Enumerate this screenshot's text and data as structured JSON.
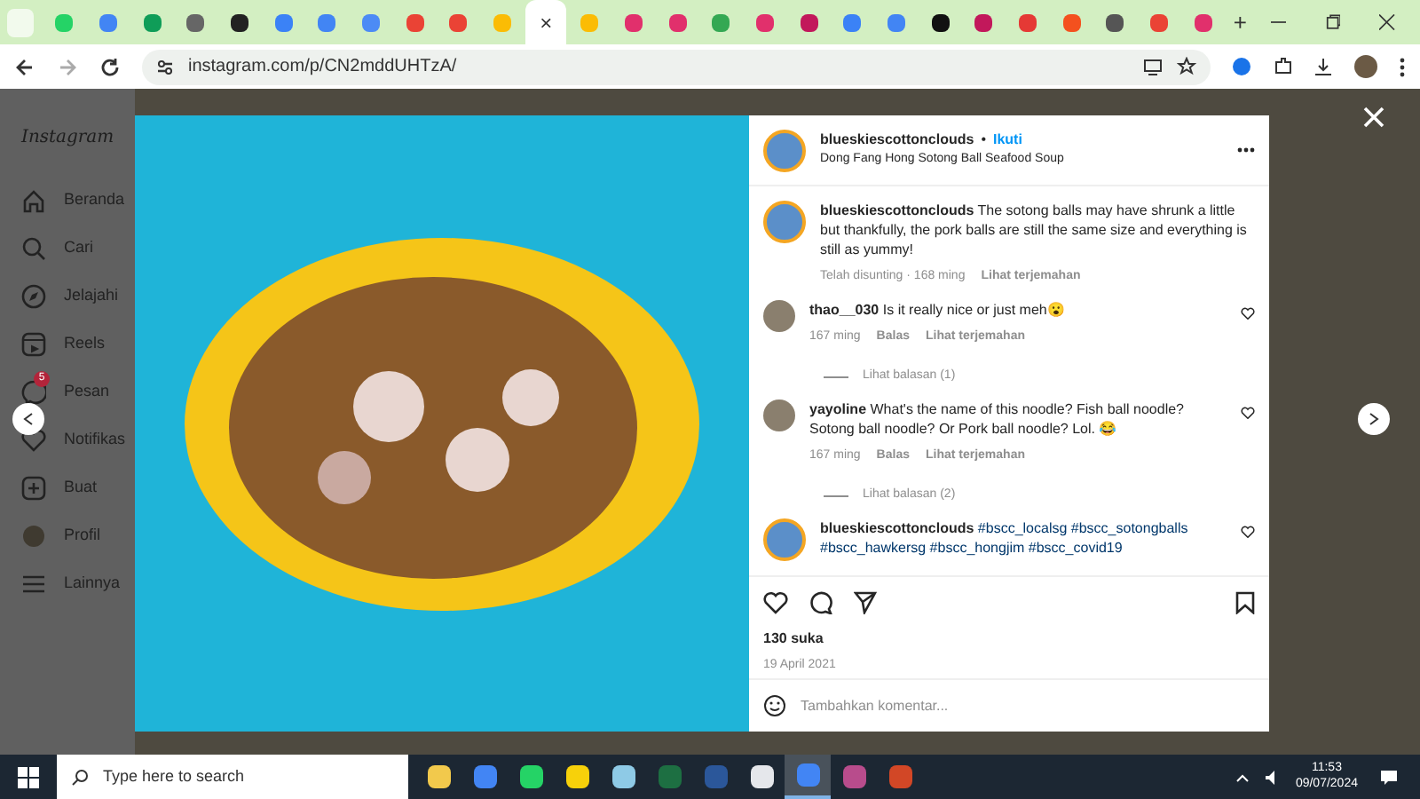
{
  "browser": {
    "tabs": [
      {
        "color": "#25d366",
        "selected": false
      },
      {
        "color": "#4285f4",
        "selected": false
      },
      {
        "color": "#0f9d58",
        "selected": false
      },
      {
        "color": "#666666",
        "selected": false
      },
      {
        "color": "#222222",
        "selected": false
      },
      {
        "color": "#3b82f6",
        "selected": false
      },
      {
        "color": "#4285f4",
        "selected": false
      },
      {
        "color": "#4c8bf5",
        "selected": false
      },
      {
        "color": "#ea4335",
        "selected": false
      },
      {
        "color": "#ea4335",
        "selected": false
      },
      {
        "color": "#fbbc05",
        "selected": false
      },
      {
        "selected": true,
        "close": "×"
      },
      {
        "color": "#fbbc05",
        "selected": false
      },
      {
        "color": "#e1306c",
        "selected": false
      },
      {
        "color": "#e1306c",
        "selected": false
      },
      {
        "color": "#34a853",
        "selected": false
      },
      {
        "color": "#e1306c",
        "selected": false
      },
      {
        "color": "#c2185b",
        "selected": false
      },
      {
        "color": "#3b82f6",
        "selected": false
      },
      {
        "color": "#4285f4",
        "selected": false
      },
      {
        "color": "#111111",
        "selected": false
      },
      {
        "color": "#c2185b",
        "selected": false
      },
      {
        "color": "#e53935",
        "selected": false
      },
      {
        "color": "#f4511e",
        "selected": false
      },
      {
        "color": "#555555",
        "selected": false
      },
      {
        "color": "#ea4335",
        "selected": false
      },
      {
        "color": "#e1306c",
        "selected": false
      }
    ],
    "new_tab": "+",
    "url": "instagram.com/p/CN2mddUHTzA/"
  },
  "sidebar": {
    "logo": "Instagram",
    "items": [
      {
        "label": "Beranda"
      },
      {
        "label": "Cari"
      },
      {
        "label": "Jelajahi"
      },
      {
        "label": "Reels"
      },
      {
        "label": "Pesan",
        "badge": "5"
      },
      {
        "label": "Notifikas"
      },
      {
        "label": "Buat"
      },
      {
        "label": "Profil"
      },
      {
        "label": "Lainnya"
      }
    ]
  },
  "post": {
    "username": "blueskiescottonclouds",
    "separator": "•",
    "follow": "Ikuti",
    "location": "Dong Fang Hong Sotong Ball Seafood Soup",
    "comments": [
      {
        "kind": "caption",
        "username": "blueskiescottonclouds",
        "text": "The sotong balls may have shrunk a little but thankfully, the pork balls are still the same size and everything is still as yummy!",
        "meta": [
          "Telah disunting · 168 ming",
          "Lihat terjemahan"
        ]
      },
      {
        "kind": "comment",
        "username": "thao__030",
        "text": "Is it really nice or just meh😮",
        "meta": [
          "167 ming",
          "Balas",
          "Lihat terjemahan"
        ],
        "replies": "Lihat balasan (1)"
      },
      {
        "kind": "comment",
        "username": "yayoline",
        "text": "What's the name of this noodle? Fish ball noodle? Sotong ball noodle? Or Pork ball noodle? Lol. 😂",
        "meta": [
          "167 ming",
          "Balas",
          "Lihat terjemahan"
        ],
        "replies": "Lihat balasan (2)"
      },
      {
        "kind": "hashtags",
        "username": "blueskiescottonclouds",
        "text": "#bscc_localsg #bscc_sotongballs #bscc_hawkersg #bscc_hongjim #bscc_covid19"
      }
    ],
    "likes": "130 suka",
    "date": "19 April 2021",
    "comment_placeholder": "Tambahkan komentar..."
  },
  "taskbar": {
    "search_placeholder": "Type here to search",
    "apps": [
      {
        "color": "#f2c94c",
        "selected": false
      },
      {
        "color": "#4285f4",
        "selected": false
      },
      {
        "color": "#25d366",
        "selected": false
      },
      {
        "color": "#f7d10a",
        "selected": false
      },
      {
        "color": "#8ecae6",
        "selected": false
      },
      {
        "color": "#1d6f42",
        "selected": false
      },
      {
        "color": "#2b579a",
        "selected": false
      },
      {
        "color": "#e5e7eb",
        "selected": false
      },
      {
        "color": "#4285f4",
        "selected": true
      },
      {
        "color": "#b84c8c",
        "selected": false
      },
      {
        "color": "#d24726",
        "selected": false
      }
    ],
    "time": "11:53",
    "date": "09/07/2024"
  }
}
